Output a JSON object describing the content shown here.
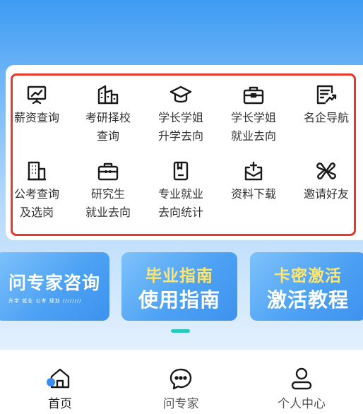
{
  "menu": {
    "items": [
      {
        "label": "薪资查询",
        "icon": "salary-chart-icon"
      },
      {
        "label": "考研择校\n查询",
        "icon": "school-building-icon"
      },
      {
        "label": "学长学姐\n升学去向",
        "icon": "graduation-cap-icon"
      },
      {
        "label": "学长学姐\n就业去向",
        "icon": "briefcase-icon"
      },
      {
        "label": "名企导航",
        "icon": "company-report-icon"
      },
      {
        "label": "公考查询\n及选岗",
        "icon": "office-building-icon"
      },
      {
        "label": "研究生\n就业去向",
        "icon": "bag-icon"
      },
      {
        "label": "专业就业\n去向统计",
        "icon": "document-icon"
      },
      {
        "label": "资料下载",
        "icon": "download-inbox-icon"
      },
      {
        "label": "邀请好友",
        "icon": "bow-icon"
      }
    ]
  },
  "banners": {
    "ask": {
      "title": "问专家咨询",
      "sub": "升学  就业  公考  规划  ////////"
    },
    "guide": {
      "line1": "毕业指南",
      "line2": "使用指南"
    },
    "card": {
      "line1": "卡密激活",
      "line2": "激活教程"
    }
  },
  "colors": {
    "accent": "#2ac9bd",
    "highlight": "#e53a2b",
    "banner_yellow": "#ffe66b"
  },
  "tabbar": {
    "home": "首页",
    "expert": "问专家",
    "profile": "个人中心"
  }
}
